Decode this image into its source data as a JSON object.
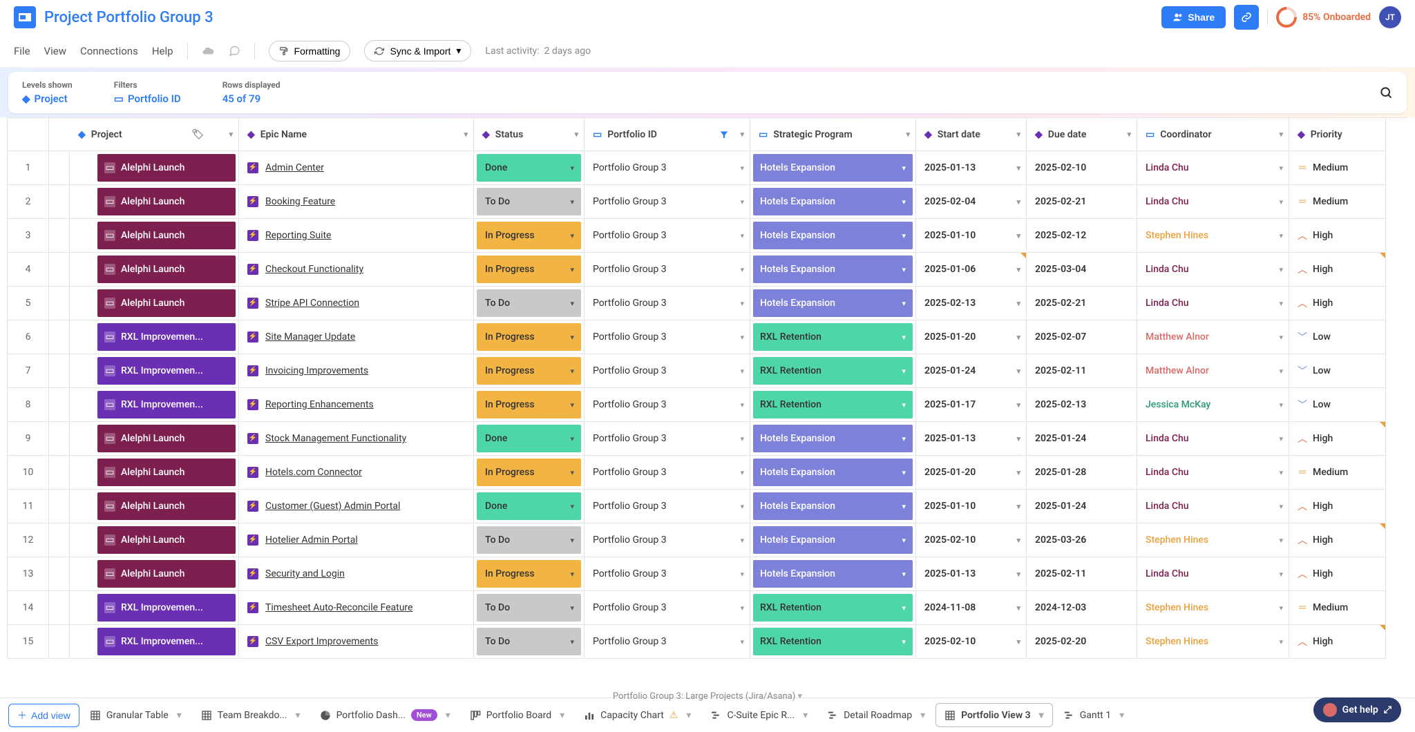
{
  "header": {
    "title": "Project Portfolio Group 3",
    "share_label": "Share",
    "onboarded": "85% Onboarded",
    "avatar": "JT"
  },
  "menubar": {
    "items": [
      "File",
      "View",
      "Connections",
      "Help"
    ],
    "formatting": "Formatting",
    "sync": "Sync & Import",
    "last_activity_label": "Last activity:",
    "last_activity_value": "2 days ago"
  },
  "filterbar": {
    "levels_label": "Levels shown",
    "levels_value": "Project",
    "filters_label": "Filters",
    "filters_value": "Portfolio ID",
    "rows_label": "Rows displayed",
    "rows_value": "45 of 79"
  },
  "columns": {
    "project": "Project",
    "epic": "Epic Name",
    "status": "Status",
    "portfolio": "Portfolio ID",
    "program": "Strategic Program",
    "start": "Start date",
    "due": "Due date",
    "coordinator": "Coordinator",
    "priority": "Priority"
  },
  "projects": {
    "alelphi": "Alelphi Launch",
    "rxl": "RXL Improvemen..."
  },
  "programs": {
    "hotels": "Hotels Expansion",
    "rxl": "RXL Retention"
  },
  "statuses": {
    "done": "Done",
    "todo": "To Do",
    "prog": "In Progress"
  },
  "priorities": {
    "high": "High",
    "medium": "Medium",
    "low": "Low"
  },
  "portfolio_value": "Portfolio Group 3",
  "rows": [
    {
      "n": 1,
      "proj": "alelphi",
      "epic": "Admin Center",
      "status": "done",
      "program": "hotels",
      "start": "2025-01-13",
      "due": "2025-02-10",
      "coord": "Linda Chu",
      "cclass": "c-linda",
      "prio": "medium"
    },
    {
      "n": 2,
      "proj": "alelphi",
      "epic": "Booking Feature",
      "status": "todo",
      "program": "hotels",
      "start": "2025-02-04",
      "due": "2025-02-21",
      "coord": "Linda Chu",
      "cclass": "c-linda",
      "prio": "medium"
    },
    {
      "n": 3,
      "proj": "alelphi",
      "epic": "Reporting Suite",
      "status": "prog",
      "program": "hotels",
      "start": "2025-01-10",
      "due": "2025-02-12",
      "coord": "Stephen Hines",
      "cclass": "c-stephen",
      "prio": "high"
    },
    {
      "n": 4,
      "proj": "alelphi",
      "epic": "Checkout Functionality",
      "status": "prog",
      "program": "hotels",
      "start": "2025-01-06",
      "due": "2025-03-04",
      "coord": "Linda Chu",
      "cclass": "c-linda",
      "prio": "high",
      "flags": [
        "start",
        "prio"
      ]
    },
    {
      "n": 5,
      "proj": "alelphi",
      "epic": "Stripe API Connection",
      "status": "todo",
      "program": "hotels",
      "start": "2025-02-13",
      "due": "2025-02-21",
      "coord": "Linda Chu",
      "cclass": "c-linda",
      "prio": "high"
    },
    {
      "n": 6,
      "proj": "rxl",
      "epic": "Site Manager Update",
      "status": "prog",
      "program": "rxl",
      "start": "2025-01-20",
      "due": "2025-02-07",
      "coord": "Matthew Alnor",
      "cclass": "c-matthew",
      "prio": "low"
    },
    {
      "n": 7,
      "proj": "rxl",
      "epic": "Invoicing Improvements",
      "status": "prog",
      "program": "rxl",
      "start": "2025-01-24",
      "due": "2025-02-11",
      "coord": "Matthew Alnor",
      "cclass": "c-matthew",
      "prio": "low"
    },
    {
      "n": 8,
      "proj": "rxl",
      "epic": "Reporting Enhancements",
      "status": "prog",
      "program": "rxl",
      "start": "2025-01-17",
      "due": "2025-02-13",
      "coord": "Jessica McKay",
      "cclass": "c-jessica",
      "prio": "low"
    },
    {
      "n": 9,
      "proj": "alelphi",
      "epic": "Stock Management Functionality",
      "status": "done",
      "program": "hotels",
      "start": "2025-01-13",
      "due": "2025-01-24",
      "coord": "Linda Chu",
      "cclass": "c-linda",
      "prio": "high",
      "flags": [
        "prio"
      ]
    },
    {
      "n": 10,
      "proj": "alelphi",
      "epic": "Hotels.com Connector",
      "status": "prog",
      "program": "hotels",
      "start": "2025-01-20",
      "due": "2025-01-28",
      "coord": "Linda Chu",
      "cclass": "c-linda",
      "prio": "medium"
    },
    {
      "n": 11,
      "proj": "alelphi",
      "epic": "Customer (Guest) Admin Portal",
      "status": "done",
      "program": "hotels",
      "start": "2025-01-10",
      "due": "2025-01-24",
      "coord": "Linda Chu",
      "cclass": "c-linda",
      "prio": "high"
    },
    {
      "n": 12,
      "proj": "alelphi",
      "epic": "Hotelier Admin Portal",
      "status": "todo",
      "program": "hotels",
      "start": "2025-02-10",
      "due": "2025-03-26",
      "coord": "Stephen Hines",
      "cclass": "c-stephen",
      "prio": "high",
      "flags": [
        "prio"
      ]
    },
    {
      "n": 13,
      "proj": "alelphi",
      "epic": "Security and Login",
      "status": "prog",
      "program": "hotels",
      "start": "2025-01-13",
      "due": "2025-02-11",
      "coord": "Linda Chu",
      "cclass": "c-linda",
      "prio": "high"
    },
    {
      "n": 14,
      "proj": "rxl",
      "epic": "Timesheet Auto-Reconcile Feature",
      "status": "todo",
      "program": "rxl",
      "start": "2024-11-08",
      "due": "2024-12-03",
      "coord": "Stephen Hines",
      "cclass": "c-stephen",
      "prio": "medium"
    },
    {
      "n": 15,
      "proj": "rxl",
      "epic": "CSV Export Improvements",
      "status": "todo",
      "program": "rxl",
      "start": "2025-02-10",
      "due": "2025-02-20",
      "coord": "Stephen Hines",
      "cclass": "c-stephen",
      "prio": "high",
      "flags": [
        "prio"
      ]
    }
  ],
  "tabs": {
    "addview": "Add view",
    "items": [
      {
        "label": "Granular Table",
        "icon": "table"
      },
      {
        "label": "Team Breakdo...",
        "icon": "table"
      },
      {
        "label": "Portfolio Dash...",
        "icon": "pie",
        "badge": "New"
      },
      {
        "label": "Portfolio Board",
        "icon": "board"
      },
      {
        "label": "Capacity Chart",
        "icon": "bars",
        "extra": "warn"
      },
      {
        "label": "C-Suite Epic R...",
        "icon": "gantt"
      },
      {
        "label": "Detail Roadmap",
        "icon": "gantt"
      },
      {
        "label": "Portfolio View 3",
        "icon": "table",
        "active": true
      },
      {
        "label": "Gantt 1",
        "icon": "gantt"
      }
    ]
  },
  "footer_note": "Portfolio Group 3: Large Projects (Jira/Asana)",
  "help": "Get help"
}
